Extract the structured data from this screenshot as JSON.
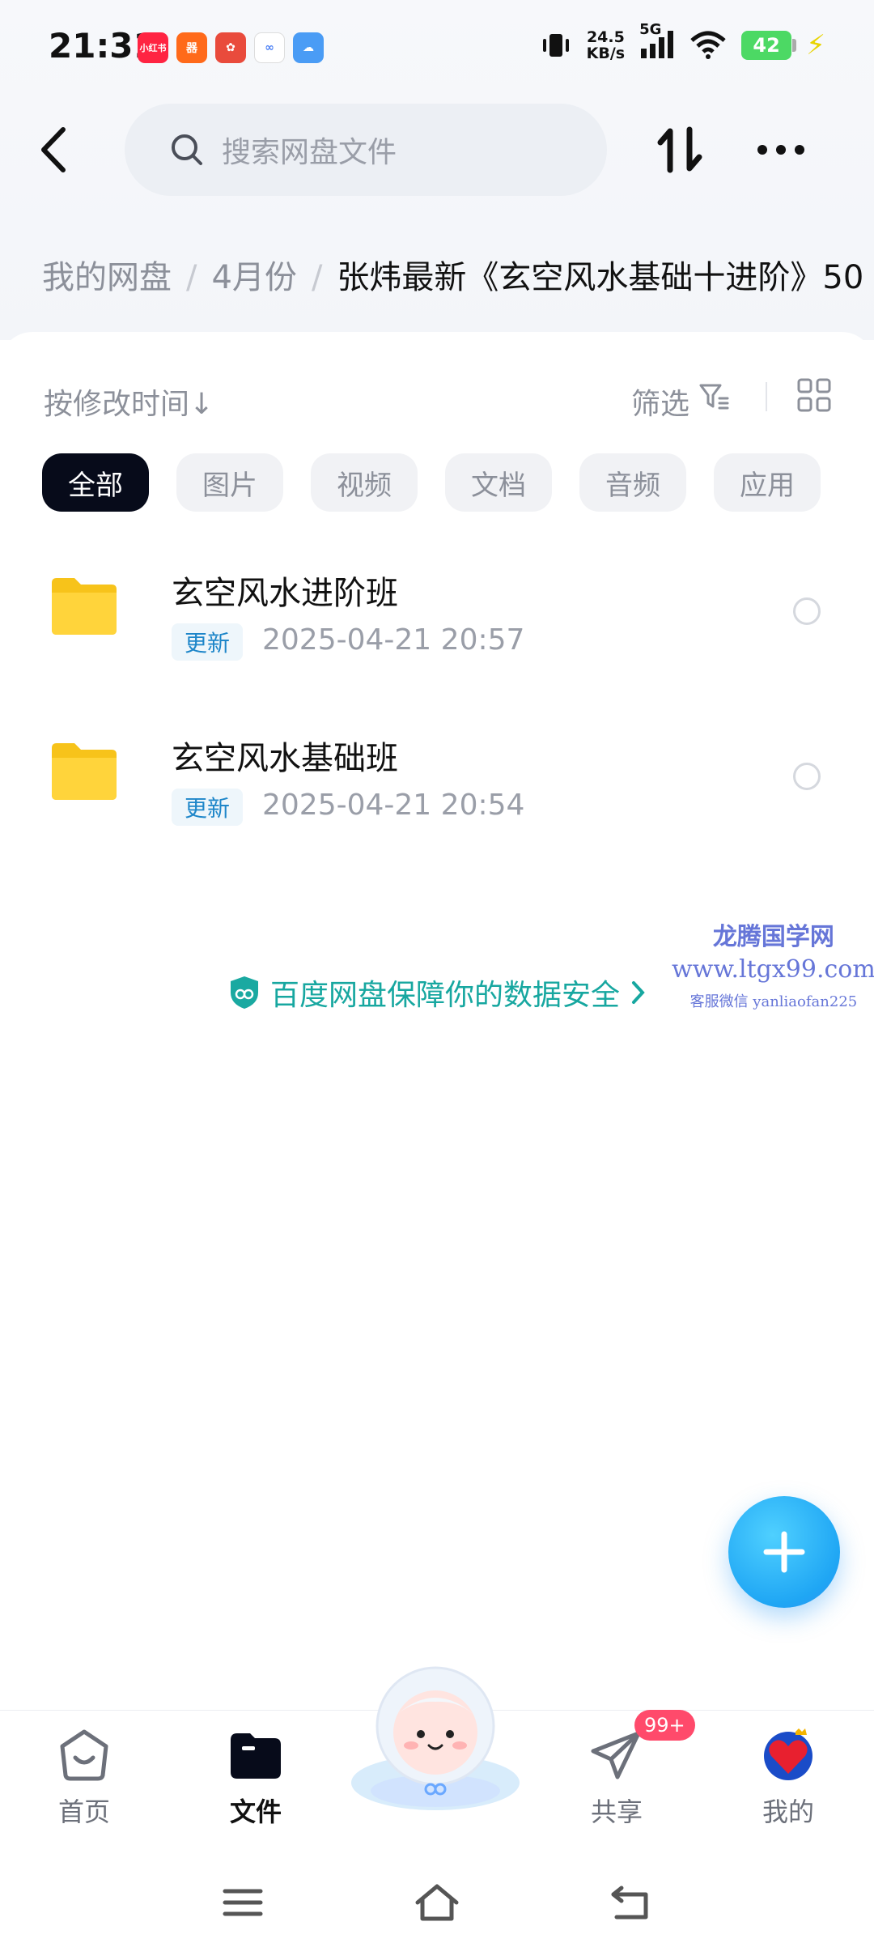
{
  "status_bar": {
    "time": "21:31",
    "speed_value": "24.5",
    "speed_unit": "KB/s",
    "network": "5G",
    "battery": "42",
    "app_icons": [
      {
        "label": "小红书",
        "color": "#ff2442"
      },
      {
        "label": "器",
        "color": "#ff6a1a"
      },
      {
        "label": "✿",
        "color": "#e94b3c"
      },
      {
        "label": "∞",
        "color": "#ffffff"
      },
      {
        "label": "☁",
        "color": "#4a9cf5"
      }
    ]
  },
  "header": {
    "search_placeholder": "搜索网盘文件"
  },
  "breadcrumb": {
    "items": [
      "我的网盘",
      "4月份"
    ],
    "current": "张炜最新《玄空风水基础十进阶》50"
  },
  "toolbar": {
    "sort_label": "按修改时间↓",
    "filter_label": "筛选"
  },
  "tabs": [
    {
      "label": "全部",
      "active": true
    },
    {
      "label": "图片",
      "active": false
    },
    {
      "label": "视频",
      "active": false
    },
    {
      "label": "文档",
      "active": false
    },
    {
      "label": "音频",
      "active": false
    },
    {
      "label": "应用",
      "active": false
    }
  ],
  "files": [
    {
      "name": "玄空风水进阶班",
      "badge": "更新",
      "date": "2025-04-21  20:57"
    },
    {
      "name": "玄空风水基础班",
      "badge": "更新",
      "date": "2025-04-21  20:54"
    }
  ],
  "safety_notice": "百度网盘保障你的数据安全",
  "watermark": {
    "line1": "龙腾国学网",
    "line2": "www.ltgx99.com",
    "line3": "客服微信 yanliaofan225"
  },
  "bottom_nav": {
    "items": [
      {
        "label": "首页",
        "active": false
      },
      {
        "label": "文件",
        "active": true
      },
      {
        "label": "共享",
        "active": false
      },
      {
        "label": "我的",
        "active": false
      }
    ],
    "share_badge": "99+"
  },
  "colors": {
    "accent": "#1fa6f4",
    "active_tab": "#070b1a",
    "update_badge": "#1e86c9",
    "safety_text": "#17a7a0"
  }
}
